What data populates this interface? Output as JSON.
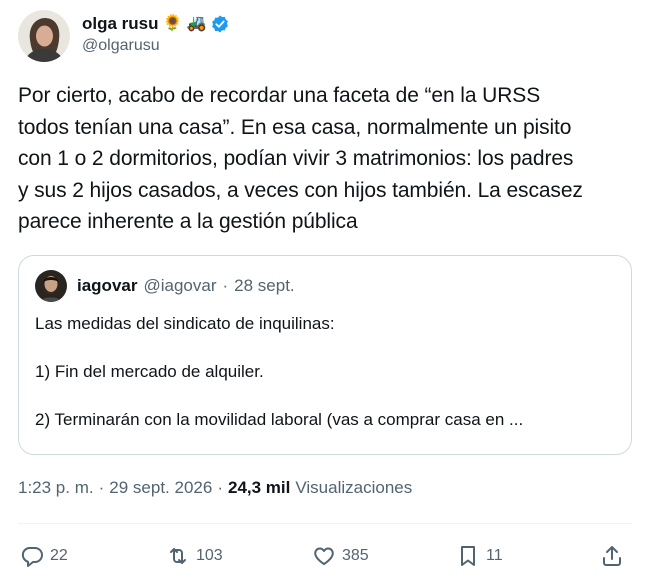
{
  "author": {
    "display_name": "olga rusu",
    "emoji_1": "🌻",
    "emoji_2": "🚜",
    "handle": "@olgarusu",
    "verified": true,
    "verified_color": "#1d9bf0"
  },
  "tweet": {
    "text": "Por cierto, acabo de recordar una faceta de “en la URSS\ntodos tenían una casa”. En esa casa, normalmente un pisito\ncon 1 o 2 dormitorios, podían vivir 3 matrimonios: los padres\ny sus 2 hijos casados, a veces con hijos también. La escasez\nparece inherente a la gestión pública"
  },
  "quoted_tweet": {
    "display_name": "iagovar",
    "handle": "@iagovar",
    "separator": "·",
    "date": "28 sept.",
    "text": "Las medidas del sindicato de inquilinas:\n\n1) Fin del mercado de alquiler.\n\n2) Terminarán con la movilidad laboral (vas a comprar casa en ..."
  },
  "meta": {
    "time": "1:23 p. m.",
    "sep1": "·",
    "date": "29 sept. 2026",
    "sep2": "·",
    "views_count": "24,3 mil",
    "views_label": "Visualizaciones"
  },
  "actions": {
    "replies": "22",
    "reposts": "103",
    "likes": "385",
    "bookmarks": "11"
  },
  "icons": [
    "verified-badge-icon",
    "reply-icon",
    "repost-icon",
    "like-icon",
    "bookmark-icon",
    "share-icon"
  ],
  "colors": {
    "text": "#0f1419",
    "secondary": "#536471",
    "border": "#cfd9de",
    "divider": "#eff3f4"
  }
}
